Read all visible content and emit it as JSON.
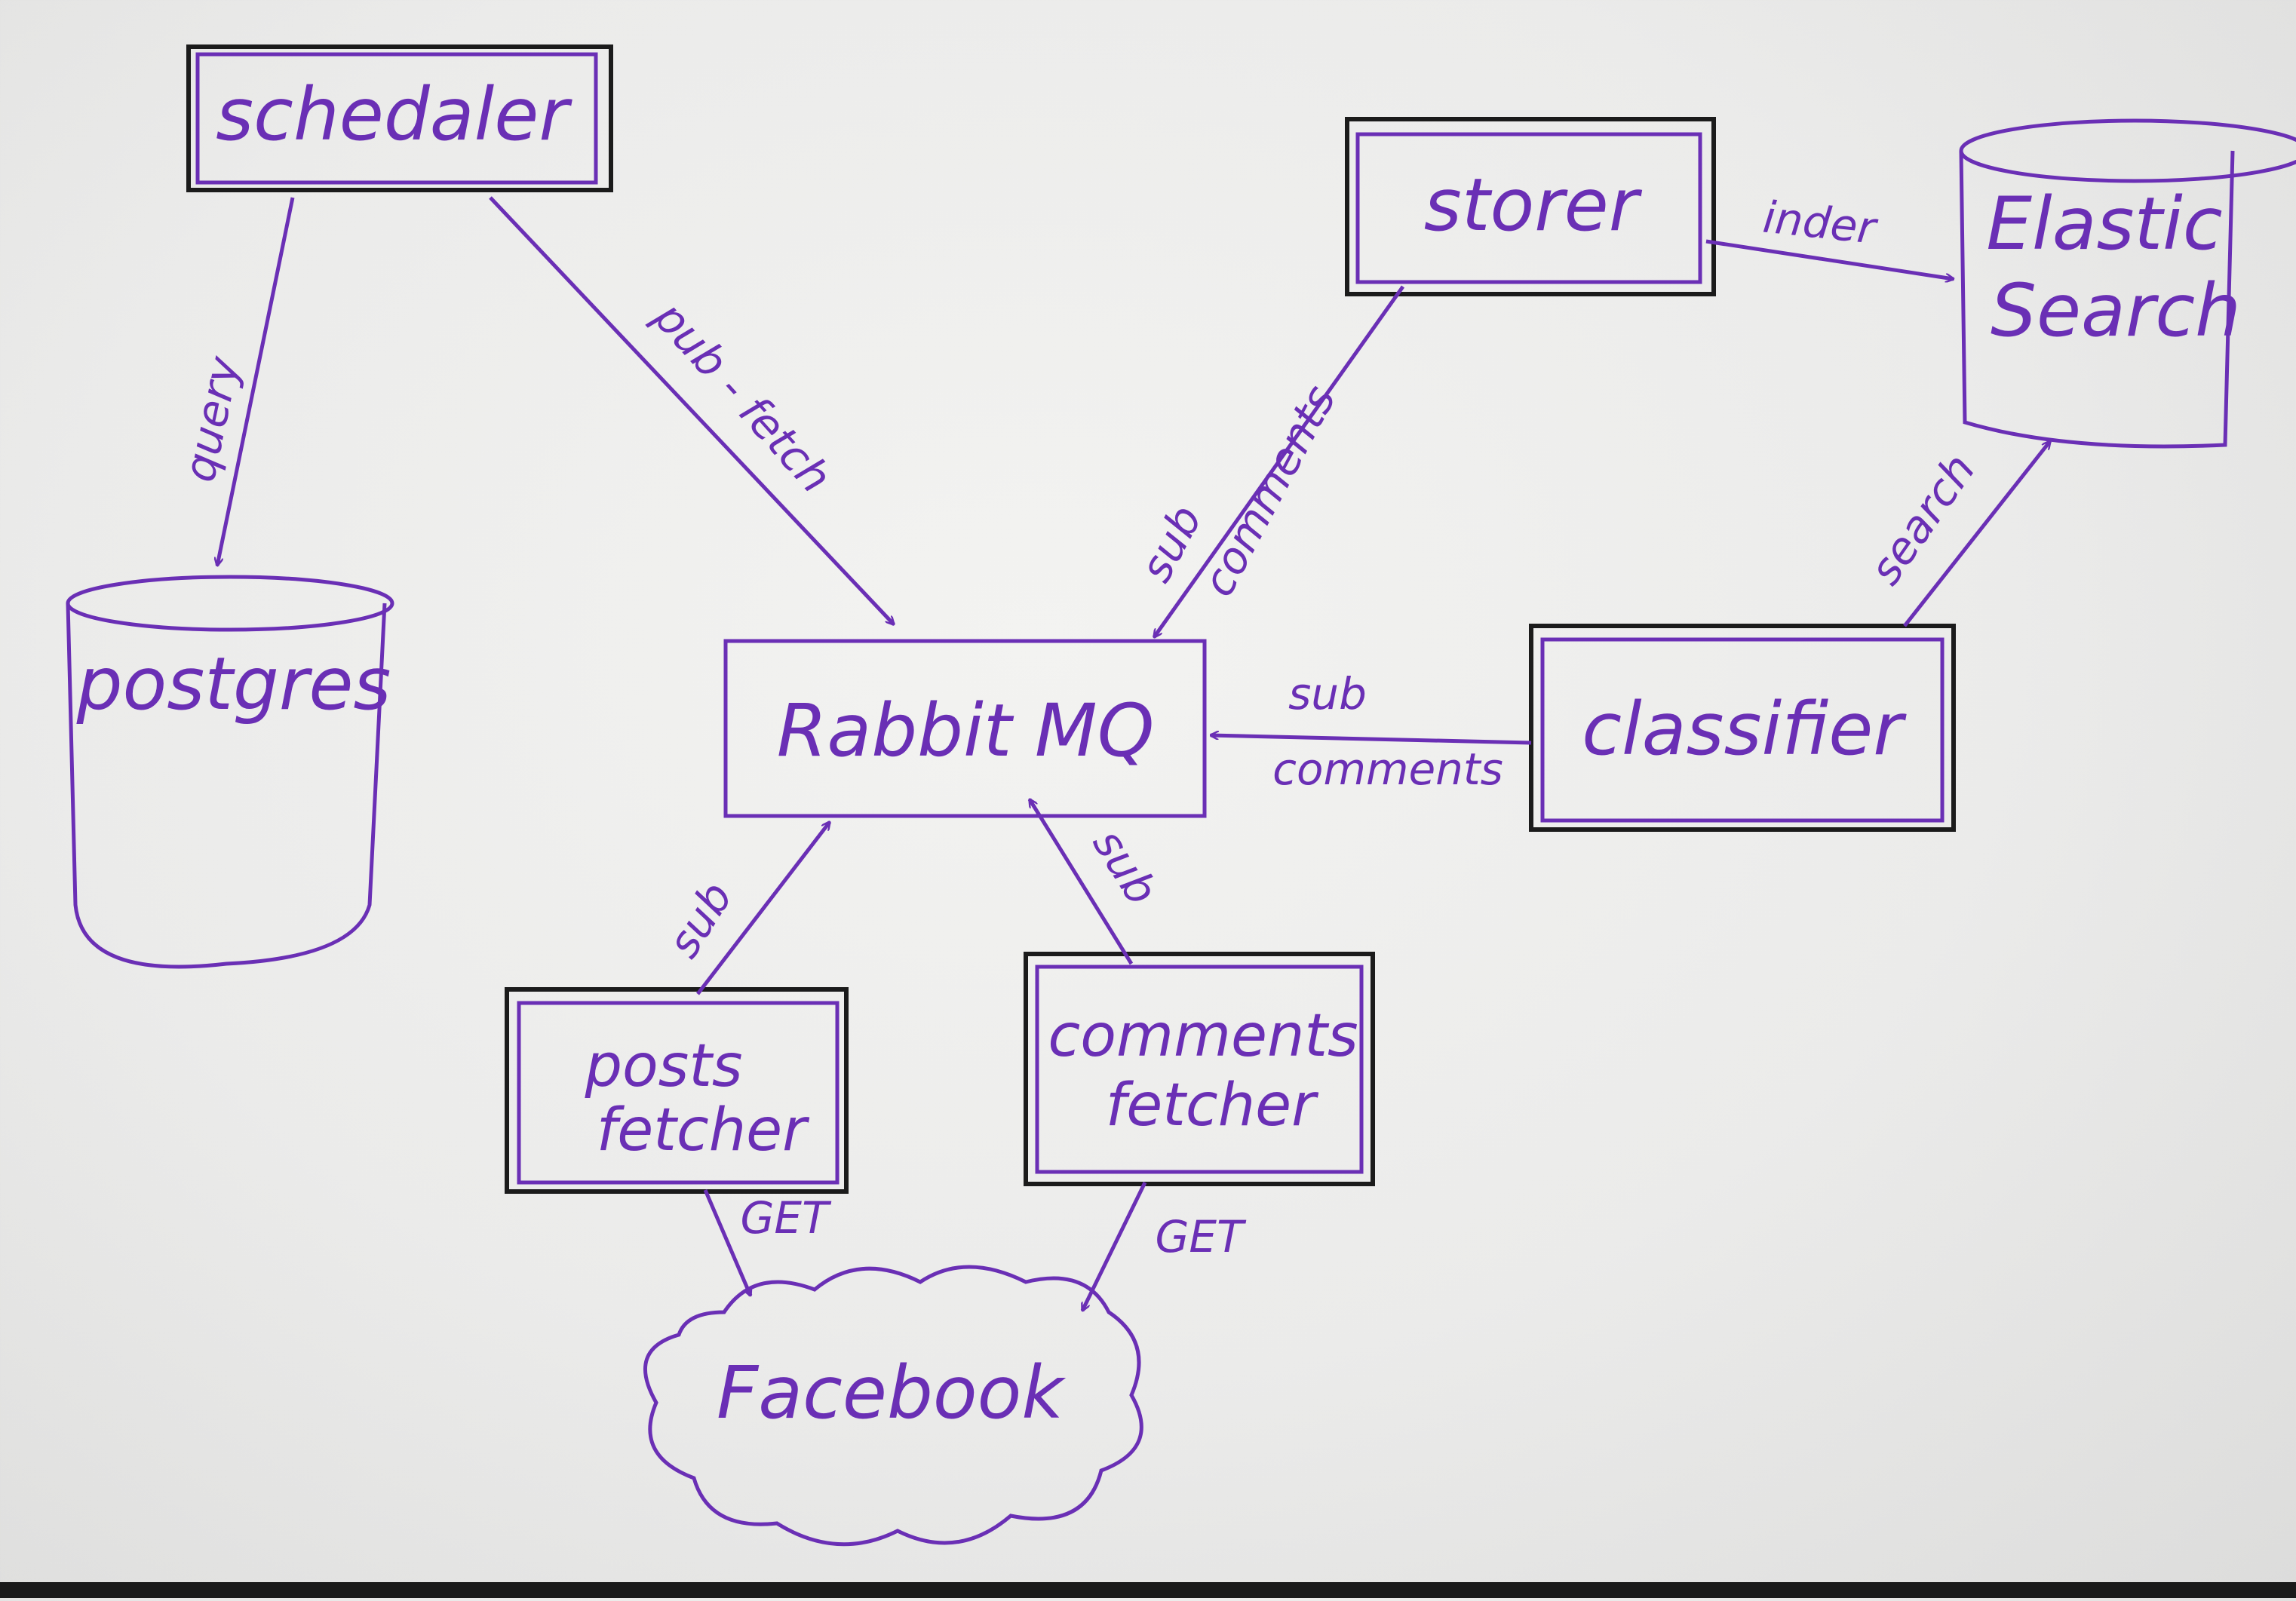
{
  "nodes": {
    "scheduler": "schedaler",
    "storer": "storer",
    "elastic_line1": "Elastic",
    "elastic_line2": "Search",
    "postgres": "postgres",
    "rabbit": "Rabbit MQ",
    "classifier": "classifier",
    "posts_line1": "posts",
    "posts_line2": "fetcher",
    "comments_line1": "comments",
    "comments_line2": "fetcher",
    "facebook": "Facebook"
  },
  "edges": {
    "query": "query",
    "pub_fetch": "pub - fetch",
    "index": "inder",
    "search": "search",
    "storer_sub": "sub",
    "storer_comments": "comments",
    "classifier_sub": "sub",
    "classifier_comments": "comments",
    "posts_sub": "sub",
    "comments_sub": "sub",
    "posts_get": "GET",
    "comments_get": "GET"
  },
  "colors": {
    "ink_purple": "#6a2fb5",
    "ink_black": "#1b1b1b",
    "paper": "#efefed"
  }
}
